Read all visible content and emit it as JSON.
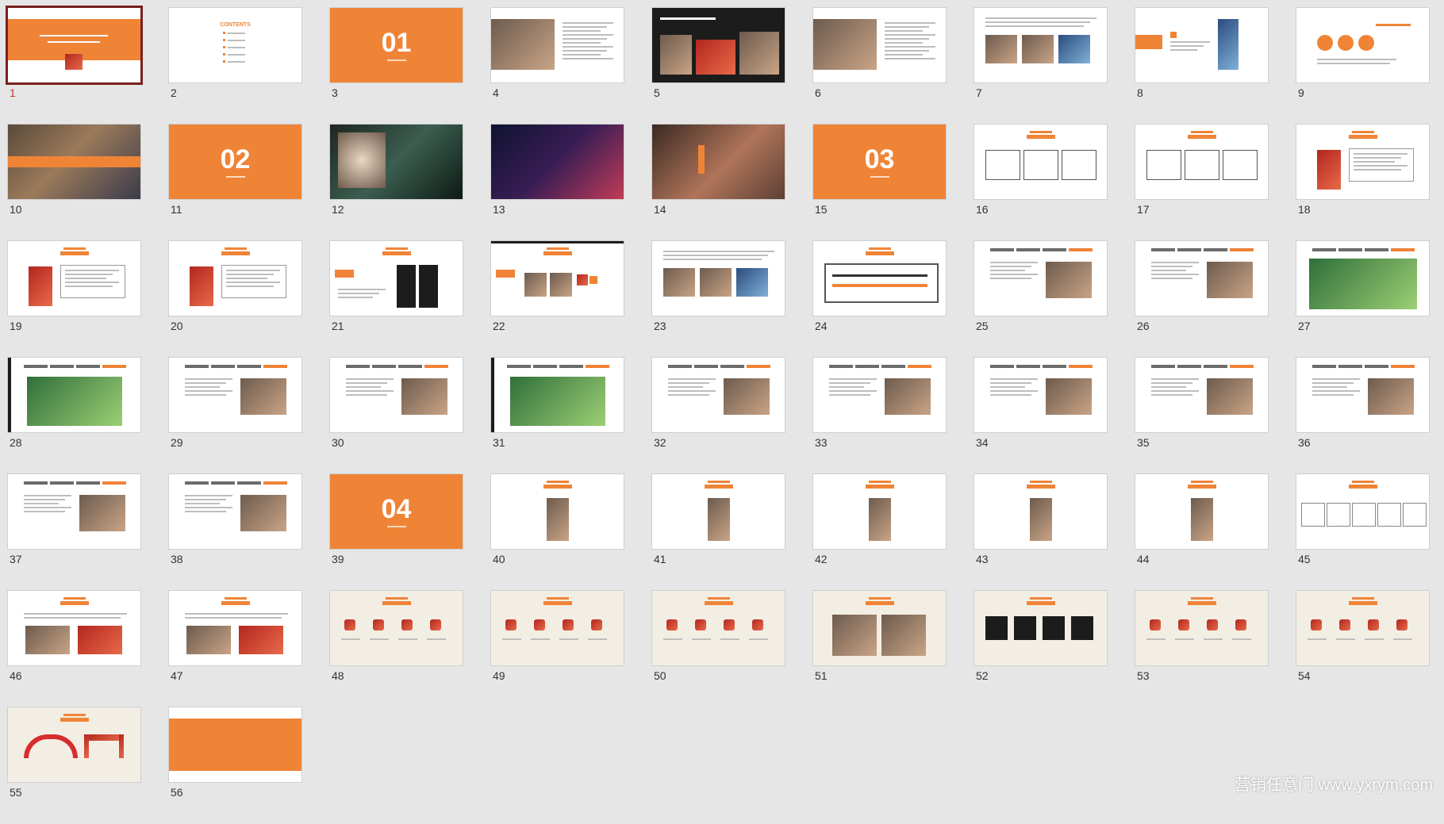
{
  "slides": [
    {
      "number": "1",
      "kind": "cover",
      "selected": true
    },
    {
      "number": "2",
      "kind": "contents",
      "heading": "CONTENTS"
    },
    {
      "number": "3",
      "kind": "section",
      "big": "01"
    },
    {
      "number": "4",
      "kind": "photo-text"
    },
    {
      "number": "5",
      "kind": "collage"
    },
    {
      "number": "6",
      "kind": "photo-text"
    },
    {
      "number": "7",
      "kind": "text-photos"
    },
    {
      "number": "8",
      "kind": "app"
    },
    {
      "number": "9",
      "kind": "circles"
    },
    {
      "number": "10",
      "kind": "photo"
    },
    {
      "number": "11",
      "kind": "section",
      "big": "02"
    },
    {
      "number": "12",
      "kind": "photo-dark"
    },
    {
      "number": "13",
      "kind": "photo-night"
    },
    {
      "number": "14",
      "kind": "photo-warm"
    },
    {
      "number": "15",
      "kind": "section",
      "big": "03"
    },
    {
      "number": "16",
      "kind": "boxes"
    },
    {
      "number": "17",
      "kind": "boxes"
    },
    {
      "number": "18",
      "kind": "mascot-text"
    },
    {
      "number": "19",
      "kind": "mascot-text"
    },
    {
      "number": "20",
      "kind": "mascot-text"
    },
    {
      "number": "21",
      "kind": "phone-text"
    },
    {
      "number": "22",
      "kind": "photos-row"
    },
    {
      "number": "23",
      "kind": "text-photos"
    },
    {
      "number": "24",
      "kind": "framed"
    },
    {
      "number": "25",
      "kind": "timeline"
    },
    {
      "number": "26",
      "kind": "timeline"
    },
    {
      "number": "27",
      "kind": "timeline-map"
    },
    {
      "number": "28",
      "kind": "timeline-green"
    },
    {
      "number": "29",
      "kind": "timeline"
    },
    {
      "number": "30",
      "kind": "timeline"
    },
    {
      "number": "31",
      "kind": "timeline-green"
    },
    {
      "number": "32",
      "kind": "timeline"
    },
    {
      "number": "33",
      "kind": "timeline"
    },
    {
      "number": "34",
      "kind": "timeline"
    },
    {
      "number": "35",
      "kind": "timeline"
    },
    {
      "number": "36",
      "kind": "timeline"
    },
    {
      "number": "37",
      "kind": "timeline"
    },
    {
      "number": "38",
      "kind": "timeline"
    },
    {
      "number": "39",
      "kind": "section",
      "big": "04"
    },
    {
      "number": "40",
      "kind": "tag-center"
    },
    {
      "number": "41",
      "kind": "tag-center"
    },
    {
      "number": "42",
      "kind": "tag-center"
    },
    {
      "number": "43",
      "kind": "tag-center"
    },
    {
      "number": "44",
      "kind": "tag-center"
    },
    {
      "number": "45",
      "kind": "tag-boxes"
    },
    {
      "number": "46",
      "kind": "tag-photos"
    },
    {
      "number": "47",
      "kind": "tag-photos"
    },
    {
      "number": "48",
      "kind": "cream"
    },
    {
      "number": "49",
      "kind": "cream"
    },
    {
      "number": "50",
      "kind": "cream"
    },
    {
      "number": "51",
      "kind": "cream-photo"
    },
    {
      "number": "52",
      "kind": "cream-shirts"
    },
    {
      "number": "53",
      "kind": "cream"
    },
    {
      "number": "54",
      "kind": "cream"
    },
    {
      "number": "55",
      "kind": "cream-arch"
    },
    {
      "number": "56",
      "kind": "band"
    }
  ],
  "watermark": "营销任意门 www.yxrym.com",
  "colors": {
    "accent": "#ef8437",
    "selected_border": "#7a1f1f",
    "background": "#e6e6e6"
  }
}
